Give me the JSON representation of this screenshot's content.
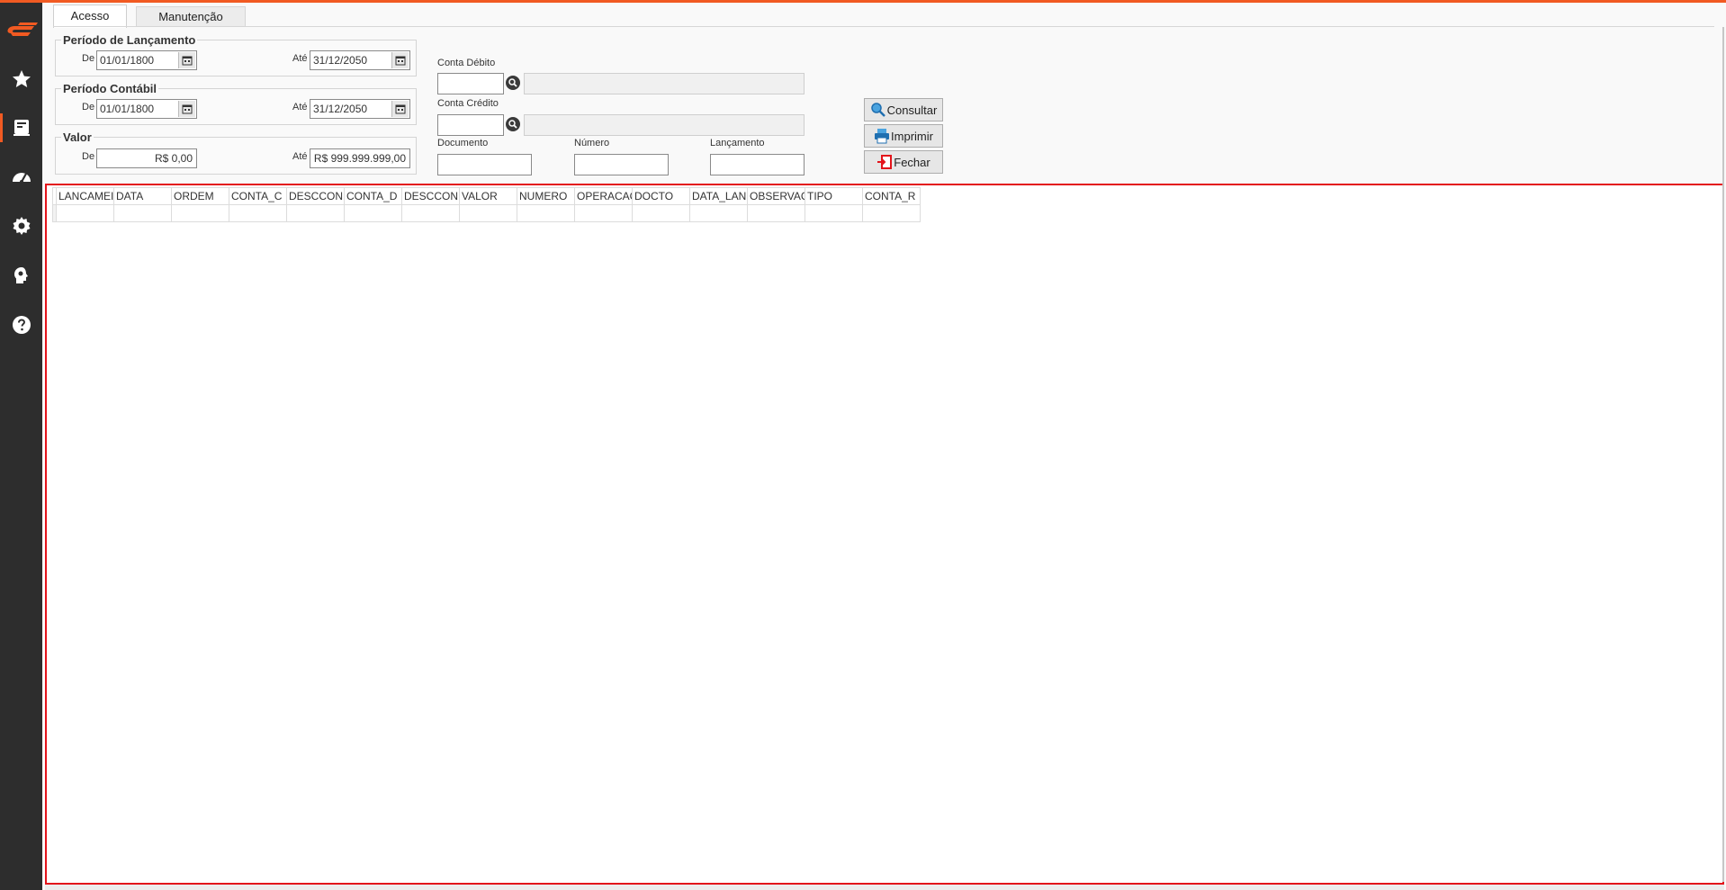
{
  "sidebar": {
    "items": [
      {
        "icon": "star-icon"
      },
      {
        "icon": "ledger-icon"
      },
      {
        "icon": "dashboard-icon"
      },
      {
        "icon": "gear-icon"
      },
      {
        "icon": "head-gear-icon"
      },
      {
        "icon": "help-icon"
      }
    ],
    "accent": "#f15a22"
  },
  "tabs": [
    {
      "label": "Acesso"
    },
    {
      "label": "Manutenção"
    }
  ],
  "periodo_lancamento": {
    "title": "Período de Lançamento",
    "de_label": "De",
    "de_value": "01/01/1800",
    "ate_label": "Até",
    "ate_value": "31/12/2050"
  },
  "periodo_contabil": {
    "title": "Período Contábil",
    "de_label": "De",
    "de_value": "01/01/1800",
    "ate_label": "Até",
    "ate_value": "31/12/2050"
  },
  "valor": {
    "title": "Valor",
    "de_label": "De",
    "de_value": "R$ 0,00",
    "ate_label": "Até",
    "ate_value": "R$ 999.999.999,00"
  },
  "conta_debito": {
    "label": "Conta Débito",
    "value": "",
    "desc": ""
  },
  "conta_credito": {
    "label": "Conta Crédito",
    "value": "",
    "desc": ""
  },
  "documento": {
    "label": "Documento",
    "value": ""
  },
  "numero": {
    "label": "Número",
    "value": ""
  },
  "lancamento": {
    "label": "Lançamento",
    "value": ""
  },
  "buttons": {
    "consultar": "Consultar",
    "imprimir": "Imprimir",
    "fechar": "Fechar"
  },
  "grid": {
    "columns": [
      "LANCAMEI",
      "DATA",
      "ORDEM",
      "CONTA_C",
      "DESCCON",
      "CONTA_D",
      "DESCCON",
      "VALOR",
      "NUMERO",
      "OPERACAC",
      "DOCTO",
      "DATA_LAN",
      "OBSERVAC",
      "TIPO",
      "CONTA_R"
    ],
    "highlight_color": "#e3141b"
  }
}
